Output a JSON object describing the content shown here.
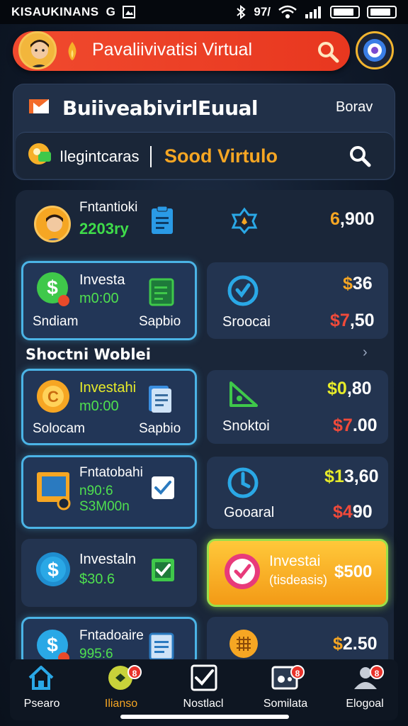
{
  "status_bar": {
    "left_text": "KISAUKINANS",
    "g_label": "G",
    "battery_text": "97/",
    "wifi_icon": "wifi-icon",
    "signal_icon": "signal-icon"
  },
  "header": {
    "title": "Pavaliivivatisi Virtual",
    "search_icon": "search-icon",
    "menu_icon": "menu-icon",
    "accent": "#f04a2e"
  },
  "business_panel": {
    "title": "BuiiveabivirlEuual",
    "right_label": "Borav",
    "search": {
      "label": "Ilegintcaras",
      "value": "Sood Virtulo"
    }
  },
  "profile": {
    "name": "Fntantioki",
    "amount": "2203ry",
    "value_prefix": "6",
    "value_rest": ",900"
  },
  "cards_row1": [
    {
      "title": "Investa",
      "amount": "m0:00",
      "left": "Sndiam",
      "right": "Sapbio"
    },
    {
      "label": "Sroocai",
      "top_prefix": "$",
      "top_value": "36",
      "bottom_prefix": "$7",
      "bottom_value": ",50"
    }
  ],
  "section": {
    "title": "Shoctni Woblei",
    "chevron": "›"
  },
  "cards_row2": [
    {
      "title": "Investahi",
      "amount": "m0:00",
      "left": "Solocam",
      "right": "Sapbio"
    },
    {
      "label": "Snoktoi",
      "top_prefix": "$0",
      "top_value": ",80",
      "bottom_prefix": "$7",
      "bottom_value": ".00"
    }
  ],
  "cards_row3": [
    {
      "title": "Fntatobahi",
      "line2": "n90:6",
      "line3": "S3M00n"
    },
    {
      "label": "Gooaral",
      "top_prefix": "$1",
      "top_value": "3,60",
      "bottom_prefix": "$4",
      "bottom_value": "90"
    }
  ],
  "cards_row4": [
    {
      "title": "Investaln",
      "amount": "$30.6"
    },
    {
      "title": "Investai",
      "subtitle": "(tisdeasis)",
      "value": "$500"
    }
  ],
  "cards_row5": [
    {
      "title": "Fntadoaire",
      "amount": "995:6"
    },
    {
      "top_prefix": "$",
      "top_value": "2.50"
    }
  ],
  "bottom_nav": [
    {
      "label": "Psearo",
      "icon": "home-icon",
      "badge": ""
    },
    {
      "label": "Ilianso",
      "icon": "chat-icon",
      "badge": "8"
    },
    {
      "label": "Nostlacl",
      "icon": "checkbox-icon",
      "badge": ""
    },
    {
      "label": "Somilata",
      "icon": "gamepad-icon",
      "badge": "8"
    },
    {
      "label": "Elogoal",
      "icon": "profile-icon",
      "badge": "8"
    }
  ]
}
